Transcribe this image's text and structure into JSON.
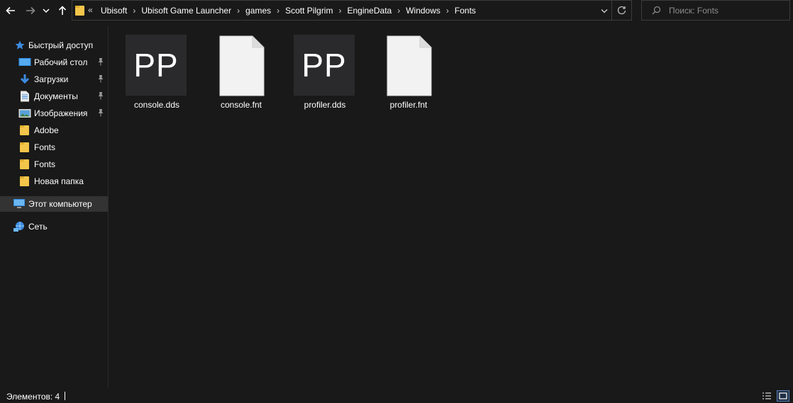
{
  "nav": {
    "back_icon": "arrow-left-icon",
    "forward_icon": "arrow-right-icon",
    "recent_icon": "chevron-down-icon",
    "up_icon": "arrow-up-icon"
  },
  "address": {
    "overflow": "«",
    "crumbs": [
      "Ubisoft",
      "Ubisoft Game Launcher",
      "games",
      "Scott Pilgrim",
      "EngineData",
      "Windows",
      "Fonts"
    ]
  },
  "search": {
    "placeholder": "Поиск: Fonts"
  },
  "sidebar": {
    "items": [
      {
        "label": "Быстрый доступ",
        "icon": "star-icon",
        "pinned": false
      },
      {
        "label": "Рабочий стол",
        "icon": "desktop-icon",
        "pinned": true
      },
      {
        "label": "Загрузки",
        "icon": "download-icon",
        "pinned": true
      },
      {
        "label": "Документы",
        "icon": "document-icon",
        "pinned": true
      },
      {
        "label": "Изображения",
        "icon": "pictures-icon",
        "pinned": true
      },
      {
        "label": "Adobe",
        "icon": "folder-icon",
        "pinned": false
      },
      {
        "label": "Fonts",
        "icon": "folder-icon",
        "pinned": false
      },
      {
        "label": "Fonts",
        "icon": "folder-icon",
        "pinned": false
      },
      {
        "label": "Новая папка",
        "icon": "folder-icon",
        "pinned": false
      },
      {
        "label": "Этот компьютер",
        "icon": "computer-icon",
        "pinned": false
      },
      {
        "label": "Сеть",
        "icon": "network-icon",
        "pinned": false
      }
    ]
  },
  "files": [
    {
      "name": "console.dds",
      "type": "dds",
      "thumb_text": "PP"
    },
    {
      "name": "console.fnt",
      "type": "file",
      "thumb_text": ""
    },
    {
      "name": "profiler.dds",
      "type": "dds",
      "thumb_text": "PP"
    },
    {
      "name": "profiler.fnt",
      "type": "file",
      "thumb_text": ""
    }
  ],
  "status": {
    "items_text": "Элементов: 4"
  },
  "colors": {
    "background": "#191919",
    "selected": "#333333",
    "folder": "#f3c54a",
    "accent": "#3c8be0"
  }
}
